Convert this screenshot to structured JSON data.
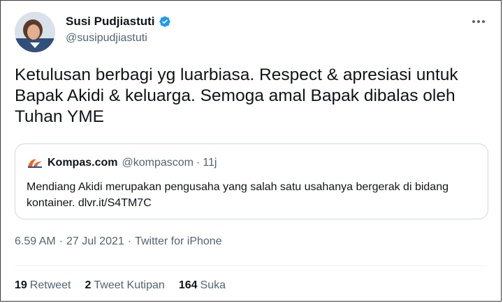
{
  "author": {
    "name": "Susi Pudjiastuti",
    "handle": "@susipudjiastuti",
    "verified": true,
    "avatar_icon": "avatar-photo"
  },
  "tweet": {
    "text": "Ketulusan berbagi yg luarbiasa. Respect & apresiasi untuk Bapak Akidi & keluarga. Semoga amal Bapak dibalas oleh Tuhan YME"
  },
  "quote": {
    "logo_icon": "kompas-logo",
    "name": "Kompas.com",
    "handle": "@kompascom",
    "separator": "·",
    "time": "11j",
    "text": "Mendiang Akidi merupakan pengusaha yang salah satu usahanya bergerak di bidang kontainer. dlvr.it/S4TM7C"
  },
  "meta": {
    "time": "6.59 AM",
    "separator1": "·",
    "date": "27 Jul 2021",
    "separator2": "·",
    "source": "Twitter for iPhone"
  },
  "stats": [
    {
      "count": "19",
      "label": "Retweet"
    },
    {
      "count": "2",
      "label": "Tweet Kutipan"
    },
    {
      "count": "164",
      "label": "Suka"
    }
  ],
  "colors": {
    "verified_blue": "#1d9bf0",
    "secondary_text": "#536471",
    "kompas_orange": "#f26522",
    "border": "#cfd9de"
  }
}
